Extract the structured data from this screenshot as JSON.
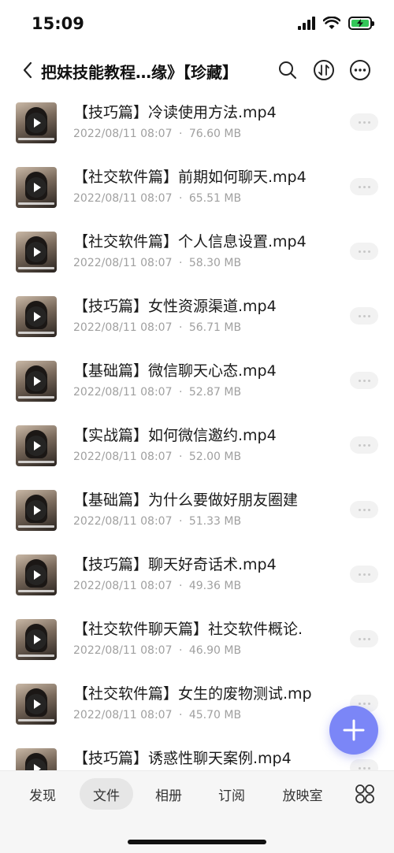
{
  "status_bar": {
    "time": "15:09",
    "battery_color": "#34c759"
  },
  "nav": {
    "title": "把妹技能教程…缘》【珍藏】",
    "icons": [
      "back-icon",
      "search-icon",
      "sort-icon",
      "more-icon"
    ]
  },
  "files": [
    {
      "name": "【技巧篇】冷读使用方法.mp4",
      "date": "2022/08/11 08:07",
      "size": "76.60 MB"
    },
    {
      "name": "【社交软件篇】前期如何聊天.mp4",
      "date": "2022/08/11 08:07",
      "size": "65.51 MB"
    },
    {
      "name": "【社交软件篇】个人信息设置.mp4",
      "date": "2022/08/11 08:07",
      "size": "58.30 MB"
    },
    {
      "name": "【技巧篇】女性资源渠道.mp4",
      "date": "2022/08/11 08:07",
      "size": "56.71 MB"
    },
    {
      "name": "【基础篇】微信聊天心态.mp4",
      "date": "2022/08/11 08:07",
      "size": "52.87 MB"
    },
    {
      "name": "【实战篇】如何微信邀约.mp4",
      "date": "2022/08/11 08:07",
      "size": "52.00 MB"
    },
    {
      "name": "【基础篇】为什么要做好朋友圈建",
      "date": "2022/08/11 08:07",
      "size": "51.33 MB"
    },
    {
      "name": "【技巧篇】聊天好奇话术.mp4",
      "date": "2022/08/11 08:07",
      "size": "49.36 MB"
    },
    {
      "name": "【社交软件聊天篇】社交软件概论.",
      "date": "2022/08/11 08:07",
      "size": "46.90 MB"
    },
    {
      "name": "【社交软件篇】女生的废物测试.mp",
      "date": "2022/08/11 08:07",
      "size": "45.70 MB"
    },
    {
      "name": "【技巧篇】诱惑性聊天案例.mp4",
      "date": "",
      "size": ""
    }
  ],
  "meta_separator": "·",
  "fab_color": "#7b86f7",
  "tabs": [
    {
      "label": "发现",
      "active": false
    },
    {
      "label": "文件",
      "active": true
    },
    {
      "label": "相册",
      "active": false
    },
    {
      "label": "订阅",
      "active": false
    },
    {
      "label": "放映室",
      "active": false
    }
  ]
}
